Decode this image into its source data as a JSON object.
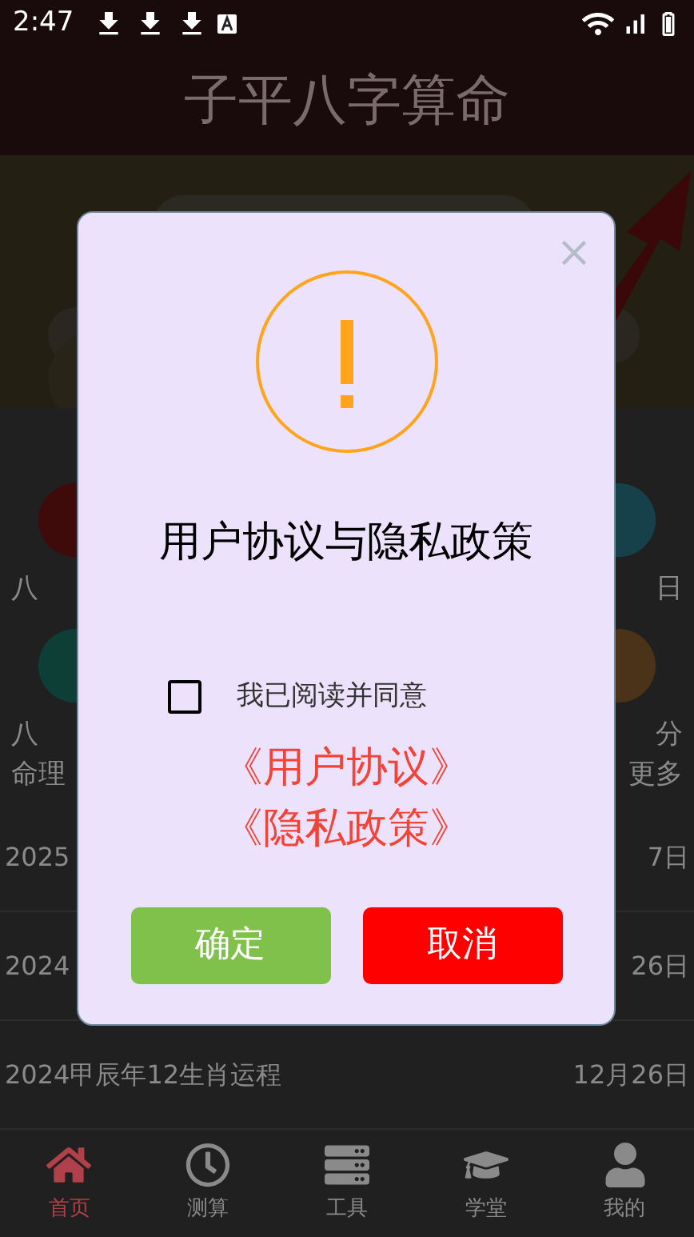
{
  "status_bar": {
    "time": "2:47"
  },
  "header": {
    "title": "子平八字算命"
  },
  "shortcuts": [
    {
      "lines": [
        "八"
      ],
      "color": "#3f0a0a"
    },
    {
      "lines": [
        "日"
      ],
      "color": "#17414a"
    },
    {
      "lines": [
        "八",
        "命理"
      ],
      "color": "#0e3f36"
    },
    {
      "lines": [
        "分",
        "更多"
      ],
      "color": "#4a3318"
    }
  ],
  "articles": [
    {
      "title": "2025",
      "date": "7日"
    },
    {
      "title": "2024",
      "date": "26日"
    },
    {
      "title": "2024甲辰年12生肖运程",
      "date": "12月26日"
    }
  ],
  "bottom_nav": [
    {
      "label": "首页",
      "selected": true
    },
    {
      "label": "测算",
      "selected": false
    },
    {
      "label": "工具",
      "selected": false
    },
    {
      "label": "学堂",
      "selected": false
    },
    {
      "label": "我的",
      "selected": false
    }
  ],
  "dialog": {
    "title": "用户协议与隐私政策",
    "agree": {
      "label": "我已阅读并同意",
      "checked": false
    },
    "links": [
      "《用户协议》",
      "《隐私政策》"
    ],
    "buttons": [
      {
        "label": "确定",
        "kind": "confirm"
      },
      {
        "label": "取消",
        "kind": "cancel"
      }
    ]
  }
}
